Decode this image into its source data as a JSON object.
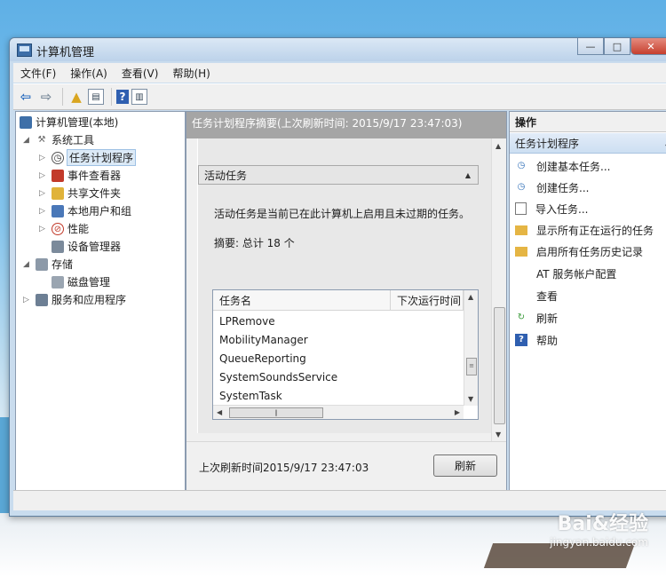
{
  "window": {
    "title": "计算机管理"
  },
  "menu": [
    "文件(F)",
    "操作(A)",
    "查看(V)",
    "帮助(H)"
  ],
  "tree": {
    "root": "计算机管理(本地)",
    "system_tools": "系统工具",
    "task_scheduler": "任务计划程序",
    "event_viewer": "事件查看器",
    "shared_folders": "共享文件夹",
    "local_users": "本地用户和组",
    "performance": "性能",
    "device_manager": "设备管理器",
    "storage": "存储",
    "disk_management": "磁盘管理",
    "services_apps": "服务和应用程序"
  },
  "middle": {
    "header": "任务计划程序摘要(上次刷新时间: 2015/9/17 23:47:03)",
    "section_title": "活动任务",
    "description": "活动任务是当前已在此计算机上启用且未过期的任务。",
    "summary": "摘要: 总计 18 个",
    "columns": [
      "任务名",
      "下次运行时间"
    ],
    "tasks": [
      "LPRemove",
      "MobilityManager",
      "QueueReporting",
      "SystemSoundsService",
      "SystemTask"
    ],
    "footer_text": "上次刷新时间2015/9/17 23:47:03",
    "refresh_button": "刷新"
  },
  "actions": {
    "header": "操作",
    "subheader": "任务计划程序",
    "items": [
      "创建基本任务...",
      "创建任务...",
      "导入任务...",
      "显示所有正在运行的任务",
      "启用所有任务历史记录",
      "AT 服务帐户配置",
      "查看",
      "刷新",
      "帮助"
    ]
  },
  "watermark": {
    "main": "Bai&经验",
    "sub": "jingyan.baidu.com"
  }
}
